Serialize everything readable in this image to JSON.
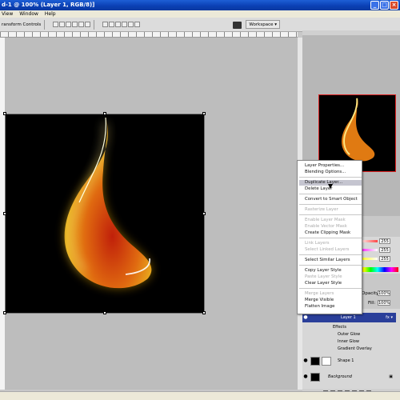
{
  "window": {
    "title": "d-1 @ 100% (Layer 1, RGB/8)]",
    "buttons": [
      "_",
      "□",
      "×"
    ]
  },
  "menubar": {
    "items": [
      "View",
      "Window",
      "Help"
    ]
  },
  "options_bar": {
    "transform_label": "ransform Controls",
    "workspace_label": "Workspace ▾"
  },
  "colors": {
    "selection": "#c5c5d0",
    "layer_selected": "#2a3f9a",
    "nav_frame": "#dd2222"
  },
  "color_panel": {
    "values": [
      "255",
      "255",
      "255"
    ]
  },
  "layers_panel": {
    "opacity_label": "Opacity:",
    "opacity_value": "100%",
    "fill_label": "Fill:",
    "fill_value": "100%",
    "layers": [
      {
        "name": "Layer 1",
        "fx": "fx ▾"
      },
      {
        "name": "Effects"
      },
      {
        "name": "Outer Glow"
      },
      {
        "name": "Inner Glow"
      },
      {
        "name": "Gradient Overlay"
      },
      {
        "name": "Shape 1"
      },
      {
        "name": "Background"
      }
    ]
  },
  "context_menu": {
    "items": [
      {
        "label": "Layer Properties...",
        "state": "enabled"
      },
      {
        "label": "Blending Options...",
        "state": "enabled"
      },
      {
        "label": "Duplicate Layer...",
        "state": "highlighted"
      },
      {
        "label": "Delete Layer",
        "state": "enabled"
      },
      {
        "label": "Convert to Smart Object",
        "state": "enabled"
      },
      {
        "label": "Rasterize Layer",
        "state": "disabled"
      },
      {
        "label": "Enable Layer Mask",
        "state": "disabled"
      },
      {
        "label": "Enable Vector Mask",
        "state": "disabled"
      },
      {
        "label": "Create Clipping Mask",
        "state": "enabled"
      },
      {
        "label": "Link Layers",
        "state": "disabled"
      },
      {
        "label": "Select Linked Layers",
        "state": "disabled"
      },
      {
        "label": "Select Similar Layers",
        "state": "enabled"
      },
      {
        "label": "Copy Layer Style",
        "state": "enabled"
      },
      {
        "label": "Paste Layer Style",
        "state": "disabled"
      },
      {
        "label": "Clear Layer Style",
        "state": "enabled"
      },
      {
        "label": "Merge Layers",
        "state": "disabled"
      },
      {
        "label": "Merge Visible",
        "state": "enabled"
      },
      {
        "label": "Flatten Image",
        "state": "enabled"
      }
    ]
  }
}
